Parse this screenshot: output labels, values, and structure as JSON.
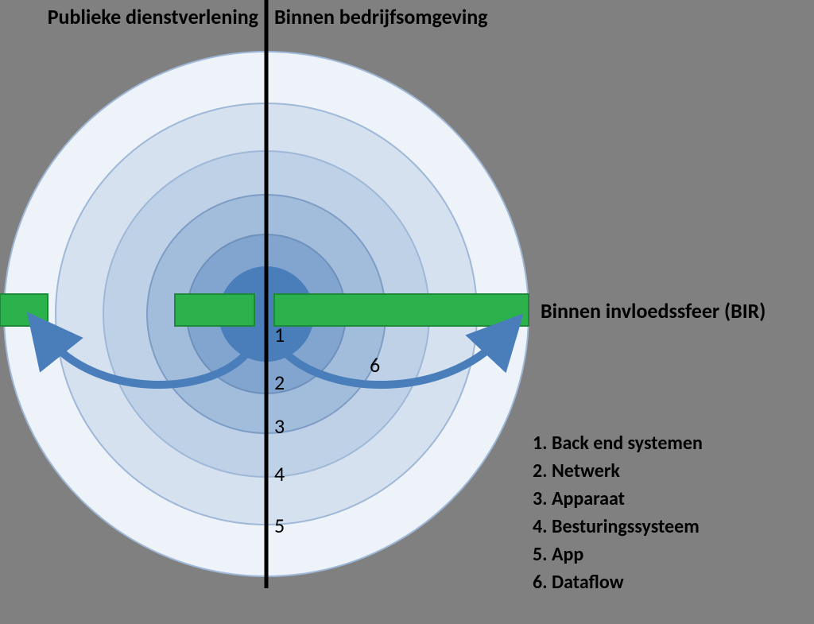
{
  "header_left": "Publieke dienstverlening",
  "header_right": "Binnen bedrijfsomgeving",
  "label_right": "Binnen invloedssfeer (BIR)",
  "ring_numbers": [
    "1",
    "2",
    "3",
    "4",
    "5"
  ],
  "six": "6",
  "legend": [
    "1. Back end systemen",
    "2. Netwerk",
    "3. Apparaat",
    "4. Besturingssysteem",
    "5. App",
    "6. Dataflow"
  ],
  "ring_meaning": {
    "1": "Back end systemen",
    "2": "Netwerk",
    "3": "Apparaat",
    "4": "Besturingssysteem",
    "5": "App",
    "6": "Dataflow"
  }
}
